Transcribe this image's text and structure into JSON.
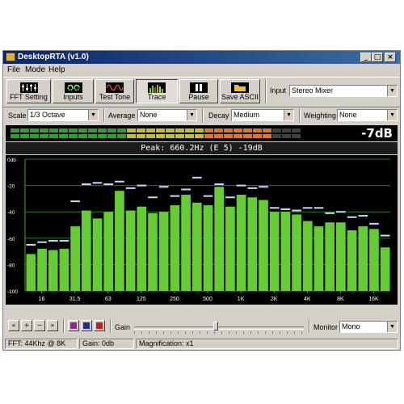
{
  "window": {
    "title": "DesktopRTA (v1.0)"
  },
  "menu": [
    "File",
    "Mode",
    "Help"
  ],
  "toolbar": {
    "buttons": [
      {
        "label": "FFT Setting",
        "icon": "sliders-icon"
      },
      {
        "label": "Swap Inputs",
        "icon": "swap-icon"
      },
      {
        "label": "Test Tone",
        "icon": "sine-wave-icon"
      },
      {
        "label": "Trace",
        "icon": "bars-trace-icon",
        "pressed": true
      },
      {
        "label": "Pause",
        "icon": "pause-icon"
      },
      {
        "label": "Save ASCII",
        "icon": "folder-icon"
      }
    ],
    "input_label": "Input",
    "input_value": "Stereo Mixer"
  },
  "options": {
    "scale_label": "Scale",
    "scale_value": "1/3 Octave",
    "average_label": "Average",
    "average_value": "None",
    "decay_label": "Decay",
    "decay_value": "Medium",
    "weighting_label": "Weighting",
    "weighting_value": "None"
  },
  "level_meter": {
    "readout": "-7dB"
  },
  "peak": {
    "text": "Peak: 660.2Hz (E 5) -19dB"
  },
  "colors": {
    "bar": "#66cc33",
    "peak_hold": "#c8d8ff",
    "grid": "#208020",
    "axis": "#40a040"
  },
  "chart_data": {
    "type": "bar",
    "y_tick_labels": [
      "0db",
      "-20",
      "-40",
      "-60",
      "-80",
      "-100"
    ],
    "ylim": [
      -100,
      0
    ],
    "x_tick_labels": [
      "16",
      "31.5",
      "63",
      "125",
      "250",
      "500",
      "1K",
      "2K",
      "4K",
      "8K",
      "16K"
    ],
    "values": [
      -72,
      -68,
      -69,
      -68,
      -51,
      -39,
      -45,
      -40,
      -24,
      -39,
      -36,
      -41,
      -40,
      -35,
      -27,
      -33,
      -35,
      -21,
      -36,
      -27,
      -29,
      -31,
      -40,
      -40,
      -42,
      -47,
      -51,
      -48,
      -48,
      -54,
      -51,
      -53,
      -67
    ],
    "peak_hold": [
      -65,
      -63,
      -62,
      -62,
      -32,
      -19,
      -18,
      -19,
      -17,
      -22,
      -20,
      -29,
      -21,
      -28,
      -23,
      -14,
      -28,
      -19,
      -29,
      -20,
      -22,
      -21,
      -37,
      -38,
      -39,
      -37,
      -37,
      -41,
      -40,
      -44,
      -43,
      -49,
      -58
    ]
  },
  "bottom": {
    "gain_label": "Gain",
    "gain_level": 0.48,
    "monitor_label": "Monitor",
    "monitor_value": "Mono",
    "transport": [
      "rewind-icon",
      "plus-icon",
      "minus-icon",
      "fast-forward-icon"
    ],
    "color_swatches": [
      "#8c2a8c",
      "#2a2a8c",
      "#c02020"
    ]
  },
  "status": {
    "fft": "FFT: 44Khz @ 8K",
    "gain": "Gain: 0db",
    "magnification": "Magnification: x1"
  }
}
